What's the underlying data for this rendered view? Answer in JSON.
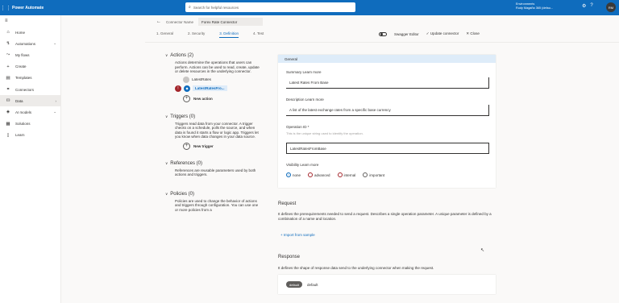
{
  "app": {
    "name": "Power Automate",
    "search_placeholder": "Search for helpful resources"
  },
  "header": {
    "env_label": "Environments",
    "env_name": "Rudy Magaña 365 (defau...",
    "avatar_initials": "RM"
  },
  "leftnav": {
    "items": [
      {
        "label": "Home",
        "icon": "home-icon"
      },
      {
        "label": "Automations",
        "icon": "automations-icon",
        "chevron": "⌄"
      },
      {
        "label": "My flows",
        "icon": "flows-icon"
      },
      {
        "label": "Create",
        "icon": "plus-icon"
      },
      {
        "label": "Templates",
        "icon": "templates-icon"
      },
      {
        "label": "Connectors",
        "icon": "connectors-icon"
      },
      {
        "label": "Data",
        "icon": "data-icon",
        "chevron": "›"
      },
      {
        "label": "AI models",
        "icon": "ai-icon",
        "chevron": "⌄"
      },
      {
        "label": "Solutions",
        "icon": "solutions-icon"
      },
      {
        "label": "Learn",
        "icon": "learn-icon"
      }
    ]
  },
  "editor": {
    "crumb_title": "Connector Name",
    "connector_name": "Forex Rate Connector",
    "steps": [
      "1. General",
      "2. Security",
      "3. Definition",
      "4. Test"
    ],
    "active_step": 2,
    "swagger_label": "Swagger Editor",
    "update_label": "Update connector",
    "close_label": "Close"
  },
  "definition_nav": {
    "actions": {
      "title": "Actions (2)",
      "desc": "Actions determine the operations that users can perform. Actions can be used to read, create, update or delete resources in the underlying connector.",
      "ops": [
        "LatestRates",
        "LatestRatesFro..."
      ],
      "new_label": "New action"
    },
    "triggers": {
      "title": "Triggers (0)",
      "desc": "Triggers read data from your connector. A trigger checks on a schedule, polls the source, and when data is found it starts a flow or logic app. Triggers let you know when data changes in your data source.",
      "new_label": "New trigger"
    },
    "references": {
      "title": "References (0)",
      "desc": "References are reusable parameters used by both actions and triggers."
    },
    "policies": {
      "title": "Policies (0)",
      "desc": "Policies are used to change the behavior of actions and triggers through configuration. You can use one or more policies from a"
    }
  },
  "general": {
    "header": "General",
    "summary_label": "Summary Learn more",
    "summary_value": "Latest Rates From Base",
    "description_label": "Description Learn more",
    "description_value": "A list of the latest exchange rates from a specific base currency",
    "operation_label": "Operation ID *",
    "operation_help": "This is the unique string used to identify the operation.",
    "operation_value": "LatestRatesFromBase",
    "visibility_label": "Visibility Learn more",
    "visibility_options": [
      "none",
      "advanced",
      "internal",
      "important"
    ],
    "visibility_selected": "none"
  },
  "request": {
    "title": "Request",
    "desc": "It defines the prerequirements needed to send a request. Describes a single operation parameter. A unique parameter is defined by a combination of a name and location.",
    "import_label": "+ Import from sample"
  },
  "response": {
    "title": "Response",
    "desc": "It defines the shape of response data send to the underlying connector when making the request.",
    "pill": "default",
    "pill_label": "default"
  }
}
